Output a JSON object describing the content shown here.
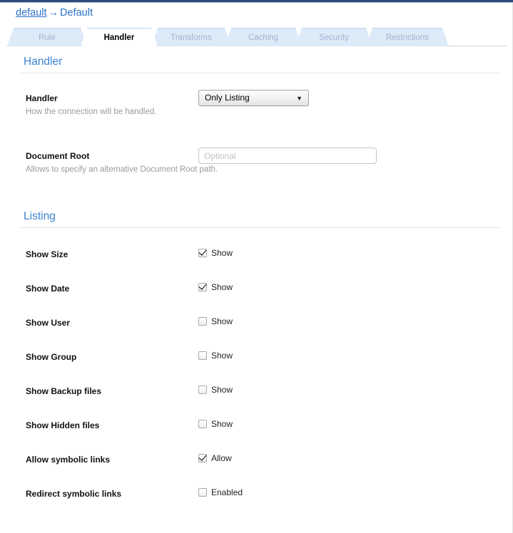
{
  "window": {
    "accent_blue": "#3c82d2",
    "top_rule_color": "#2b4b7d",
    "tab_fill": "#ddeaf8",
    "tab_border": "#b9d3ef"
  },
  "breadcrumb": {
    "root_label": "default",
    "separator": "→",
    "current_label": "Default"
  },
  "tabs": [
    {
      "label": "Rule",
      "active": false
    },
    {
      "label": "Handler",
      "active": true
    },
    {
      "label": "Transforms",
      "active": false
    },
    {
      "label": "Caching",
      "active": false
    },
    {
      "label": "Security",
      "active": false
    },
    {
      "label": "Restrictions",
      "active": false
    }
  ],
  "sections": [
    {
      "title": "Handler",
      "rows": [
        {
          "label": "Handler",
          "help": "How the connection will be handled.",
          "control": "select",
          "value": "Only Listing",
          "caret_glyph": "▼"
        },
        {
          "label": "Document Root",
          "help": "Allows to specify an alternative Document Root path.",
          "control": "text",
          "value": "",
          "placeholder": "Optional"
        }
      ]
    },
    {
      "title": "Listing",
      "rows": [
        {
          "label": "Show Size",
          "control": "checkbox",
          "check_label": "Show",
          "checked": true
        },
        {
          "label": "Show Date",
          "control": "checkbox",
          "check_label": "Show",
          "checked": true
        },
        {
          "label": "Show User",
          "control": "checkbox",
          "check_label": "Show",
          "checked": false
        },
        {
          "label": "Show Group",
          "control": "checkbox",
          "check_label": "Show",
          "checked": false
        },
        {
          "label": "Show Backup files",
          "control": "checkbox",
          "check_label": "Show",
          "checked": false
        },
        {
          "label": "Show Hidden files",
          "control": "checkbox",
          "check_label": "Show",
          "checked": false
        },
        {
          "label": "Allow symbolic links",
          "control": "checkbox",
          "check_label": "Allow",
          "checked": true
        },
        {
          "label": "Redirect symbolic links",
          "control": "checkbox",
          "check_label": "Enabled",
          "checked": false
        }
      ]
    }
  ]
}
